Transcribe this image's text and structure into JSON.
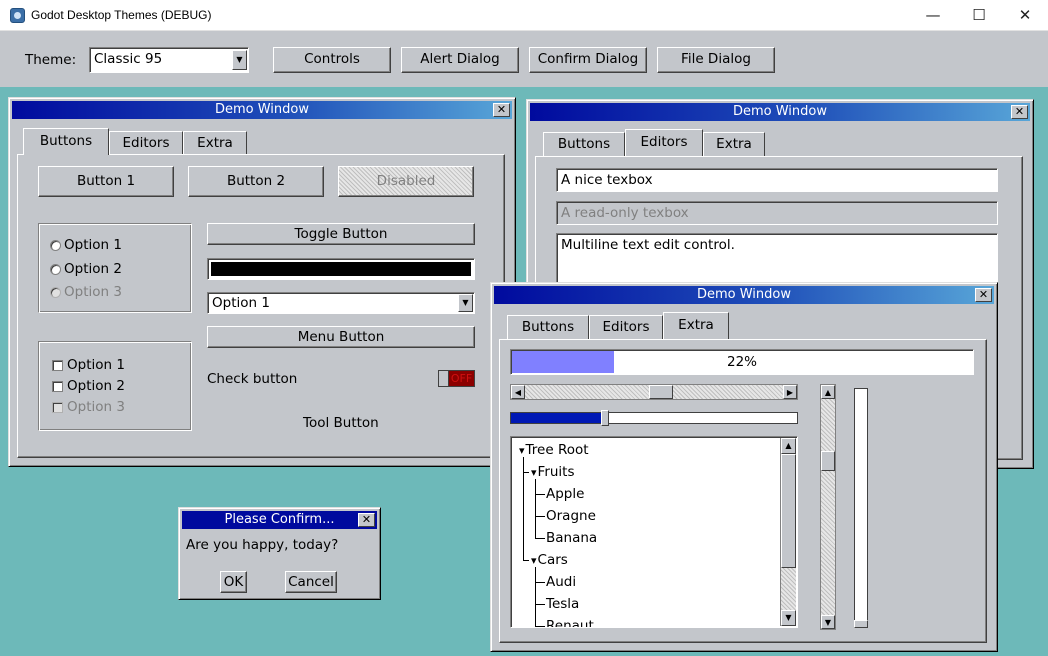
{
  "os_window": {
    "title": "Godot Desktop Themes (DEBUG)",
    "minimize": "—",
    "maximize": "☐",
    "close": "✕"
  },
  "toolbar": {
    "theme_label": "Theme:",
    "theme_value": "Classic 95",
    "buttons": [
      "Controls",
      "Alert Dialog",
      "Confirm Dialog",
      "File Dialog"
    ]
  },
  "demo_window_1": {
    "title": "Demo Window",
    "tabs": [
      "Buttons",
      "Editors",
      "Extra"
    ],
    "active_tab": "Buttons",
    "buttons": [
      "Button 1",
      "Button 2",
      "Disabled"
    ],
    "radio_options": [
      "Option 1",
      "Option 2",
      "Option 3"
    ],
    "toggle_button": "Toggle Button",
    "option_select": "Option 1",
    "menu_button": "Menu Button",
    "check_options": [
      "Option 1",
      "Option 2",
      "Option 3"
    ],
    "check_button_label": "Check button",
    "switch_state": "OFF",
    "tool_button": "Tool Button"
  },
  "demo_window_2": {
    "title": "Demo Window",
    "tabs": [
      "Buttons",
      "Editors",
      "Extra"
    ],
    "active_tab": "Editors",
    "textbox": "A nice texbox",
    "readonly_textbox": "A read-only texbox",
    "multiline": "Multiline text edit control."
  },
  "demo_window_3": {
    "title": "Demo Window",
    "tabs": [
      "Buttons",
      "Editors",
      "Extra"
    ],
    "active_tab": "Extra",
    "progress": {
      "value": 22,
      "label": "22%"
    },
    "hslider_value": 0.33,
    "tree": [
      {
        "label": "Tree Root",
        "level": 0,
        "expanded": true
      },
      {
        "label": "Fruits",
        "level": 1,
        "expanded": true
      },
      {
        "label": "Apple",
        "level": 2
      },
      {
        "label": "Oragne",
        "level": 2
      },
      {
        "label": "Banana",
        "level": 2
      },
      {
        "label": "Cars",
        "level": 1,
        "expanded": true
      },
      {
        "label": "Audi",
        "level": 2
      },
      {
        "label": "Tesla",
        "level": 2
      },
      {
        "label": "Renaut",
        "level": 2
      }
    ]
  },
  "confirm_dialog": {
    "title": "Please Confirm...",
    "message": "Are you happy, today?",
    "ok": "OK",
    "cancel": "Cancel"
  },
  "colors": {
    "desktop": "#6db9b9",
    "face": "#c3c6cb",
    "title_start": "#000a9e",
    "title_end": "#58a6d8",
    "progress_fill": "#8080ff",
    "slider_fill": "#0018b4"
  }
}
